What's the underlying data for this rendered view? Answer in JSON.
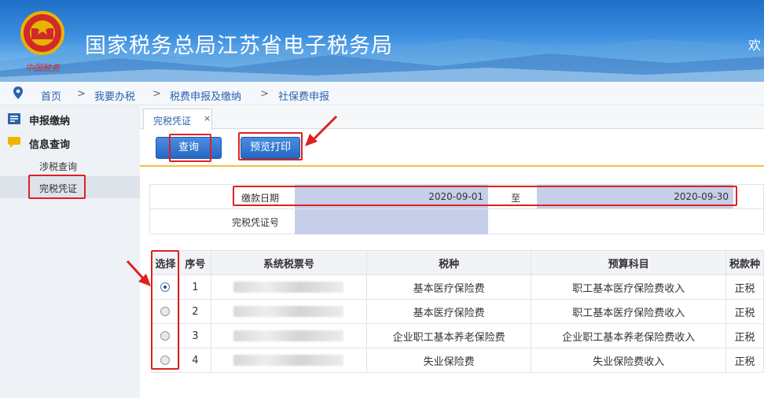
{
  "banner": {
    "title": "国家税务总局江苏省电子税务局",
    "welcome": "欢"
  },
  "breadcrumb": [
    {
      "label": "首页"
    },
    {
      "label": "我要办税"
    },
    {
      "label": "税费申报及缴纳"
    },
    {
      "label": "社保费申报"
    }
  ],
  "breadcrumb_sep": ">",
  "sidebar": {
    "items": [
      {
        "label": "申报缴纳",
        "icon": "declare-icon"
      },
      {
        "label": "信息查询",
        "icon": "chat-bubble-icon"
      }
    ],
    "subitems": [
      {
        "label": "涉税查询"
      },
      {
        "label": "完税凭证",
        "active": true
      }
    ]
  },
  "tab": {
    "label": "完税凭证",
    "close": "×"
  },
  "toolbar": {
    "query_label": "查询",
    "print_label": "预览打印"
  },
  "form": {
    "date_label": "缴款日期",
    "date_from": "2020-09-01",
    "date_to_sep": "至",
    "date_to": "2020-09-30",
    "cert_label": "完税凭证号",
    "cert_value": ""
  },
  "table": {
    "headers": [
      "选择",
      "序号",
      "系统税票号",
      "税种",
      "预算科目",
      "税款种"
    ],
    "rows": [
      {
        "selected": true,
        "no": "1",
        "tax": "基本医疗保险费",
        "budget": "职工基本医疗保险费收入",
        "kind": "正税"
      },
      {
        "selected": false,
        "no": "2",
        "tax": "基本医疗保险费",
        "budget": "职工基本医疗保险费收入",
        "kind": "正税"
      },
      {
        "selected": false,
        "no": "3",
        "tax": "企业职工基本养老保险费",
        "budget": "企业职工基本养老保险费收入",
        "kind": "正税"
      },
      {
        "selected": false,
        "no": "4",
        "tax": "失业保险费",
        "budget": "失业保险费收入",
        "kind": "正税"
      }
    ]
  },
  "colors": {
    "highlight": "#e02020",
    "accent": "#2a63ad",
    "field": "#c6cfe9"
  }
}
